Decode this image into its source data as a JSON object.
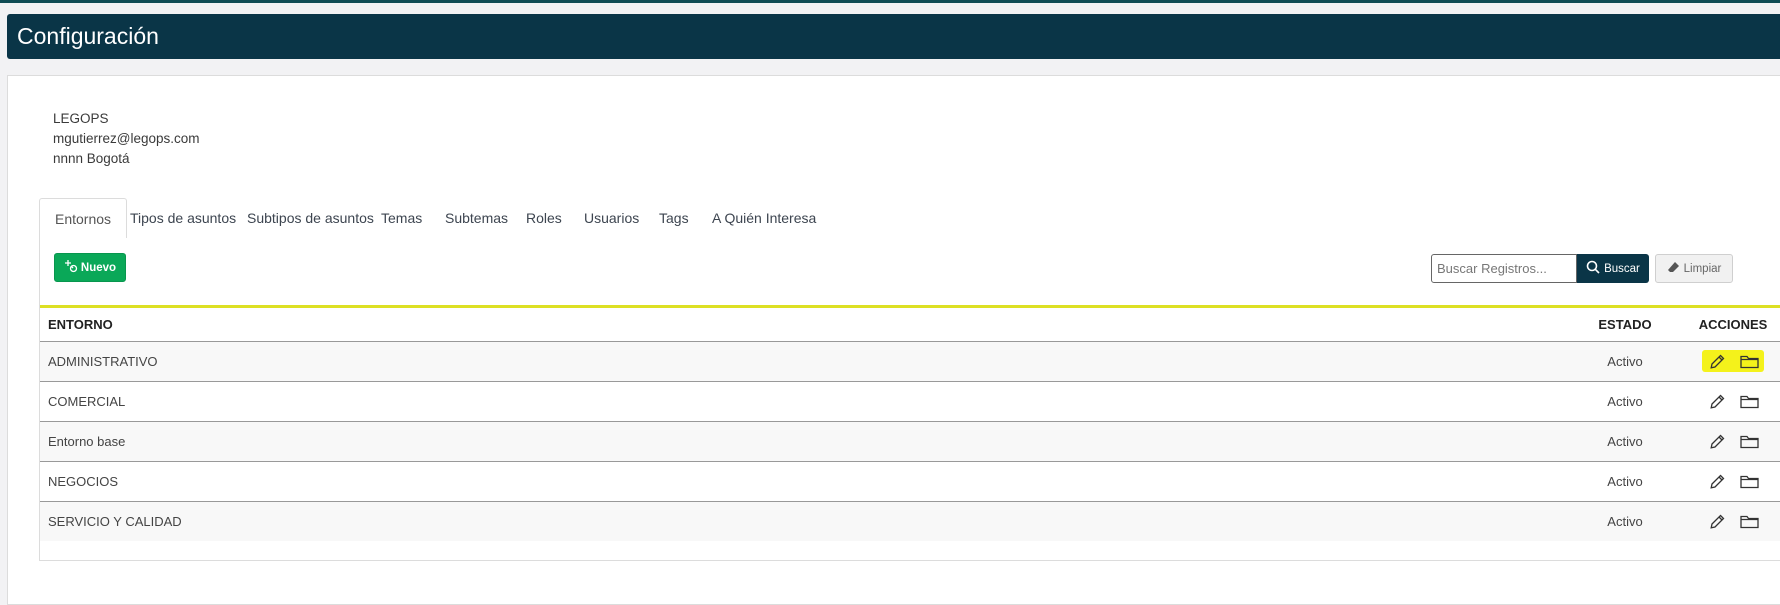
{
  "header": {
    "title": "Configuración"
  },
  "company": {
    "name": "LEGOPS",
    "email": "mgutierrez@legops.com",
    "location": "nnnn Bogotá"
  },
  "tabs": [
    {
      "label": "Entornos",
      "active": true
    },
    {
      "label": "Tipos de asuntos"
    },
    {
      "label": "Subtipos de asuntos"
    },
    {
      "label": "Temas"
    },
    {
      "label": "Subtemas"
    },
    {
      "label": "Roles"
    },
    {
      "label": "Usuarios"
    },
    {
      "label": "Tags"
    },
    {
      "label": "A Quién Interesa"
    }
  ],
  "toolbar": {
    "new_label": "Nuevo",
    "search_placeholder": "Buscar Registros...",
    "search_label": "Buscar",
    "clear_label": "Limpiar"
  },
  "table": {
    "headers": {
      "entorno": "ENTORNO",
      "estado": "ESTADO",
      "acciones": "ACCIONES"
    },
    "rows": [
      {
        "entorno": "ADMINISTRATIVO",
        "estado": "Activo",
        "highlighted": true
      },
      {
        "entorno": "COMERCIAL",
        "estado": "Activo"
      },
      {
        "entorno": "Entorno base",
        "estado": "Activo"
      },
      {
        "entorno": "NEGOCIOS",
        "estado": "Activo"
      },
      {
        "entorno": "SERVICIO Y CALIDAD",
        "estado": "Activo"
      }
    ]
  },
  "colors": {
    "header_bg": "#0a3547",
    "new_button": "#0aa858",
    "highlight": "#f4f21b",
    "accent_line": "#dde023"
  },
  "icons": {
    "edit": "pencil-icon",
    "folder": "folder-icon",
    "search": "search-icon",
    "eraser": "eraser-icon",
    "new": "add-icon"
  }
}
